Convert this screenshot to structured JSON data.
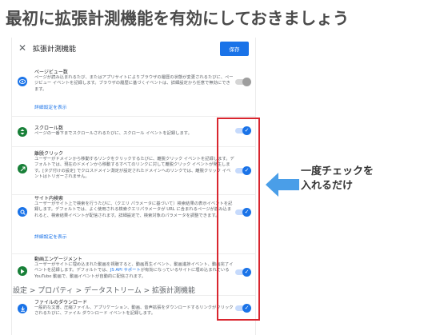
{
  "heading": "最初に拡張計測機能を有効にしておきましょう",
  "panel": {
    "close_icon": "✕",
    "title": "拡張計測機能",
    "save_label": "保存"
  },
  "rows": [
    {
      "title": "ページビュー数",
      "desc": "ページが読み込まれるたび、またはアプリサイトによりブラウザの履歴の状態が変更されるたびに、ページビュー イベントを記録します。ブラウザの履歴に基づくイベントは、詳細設定から任意で無効にできます。",
      "link": "詳細設定を表示",
      "toggle_on": false,
      "icon": "eye-icon",
      "icon_color": "#1a73e8"
    },
    {
      "title": "スクロール数",
      "desc": "ページの一番下までスクロールされるたびに、スクロール イベントを記録します。",
      "toggle_on": true,
      "icon": "scroll-icon",
      "icon_color": "#188038"
    },
    {
      "title": "離脱クリック",
      "desc": "ユーザーがドメインから移動するリンクをクリックするたびに、離脱クリック イベントを記録します。デフォルトでは、現在のドメインから移動するすべてのリンクに対して離脱クリック イベントが発生します。[タグ付けの設定] でクロスドメイン測定が設定されたドメインへのリンクでは、離脱クリック イベントはトリガーされません。",
      "toggle_on": true,
      "icon": "outbound-click-icon",
      "icon_color": "#188038"
    },
    {
      "title": "サイト内検索",
      "desc": "ユーザーがサイト上で検索を行うたびに、（クエリ パラメータに基づいて）検索結果の表示イベントを記録します。デフォルトでは、よく使用される検索クエリパラメータが URL に含まれるページが読み込まれると、検索結果イベントが配信されます。詳細設定で、検索対象のパラメータを調整できます。",
      "link": "詳細設定を表示",
      "toggle_on": true,
      "icon": "search-icon",
      "icon_color": "#1a73e8"
    },
    {
      "title": "動画エンゲージメント",
      "desc_before": "ユーザーがサイトに埋め込まれた動画を視聴すると、動画再生イベント、動画進捗イベント、動画完了イベントを記録します。デフォルトでは、",
      "desc_link": "JS API サポート",
      "desc_after": "が有効になっているサイトに埋め込まれている YouTube 動画で、動画イベントが自動的に配信されます。",
      "toggle_on": true,
      "icon": "play-icon",
      "icon_color": "#188038"
    },
    {
      "title": "ファイルのダウンロード",
      "desc": "一般的な文書、圧縮ファイル、アプリケーション、動画、音声拡張をダウンロードするリンクがクリックされるたびに、ファイル ダウンロード イベントを記録します。",
      "toggle_on": true,
      "icon": "download-icon",
      "icon_color": "#1a73e8"
    }
  ],
  "annotation": {
    "line1": "一度チェックを",
    "line2": "入れるだけ"
  },
  "breadcrumb": "設定 > プロパティ > データストリーム > 拡張計測機能",
  "colors": {
    "accent": "#1a73e8",
    "highlight": "#d9262f",
    "arrow": "#4a9ee8"
  }
}
